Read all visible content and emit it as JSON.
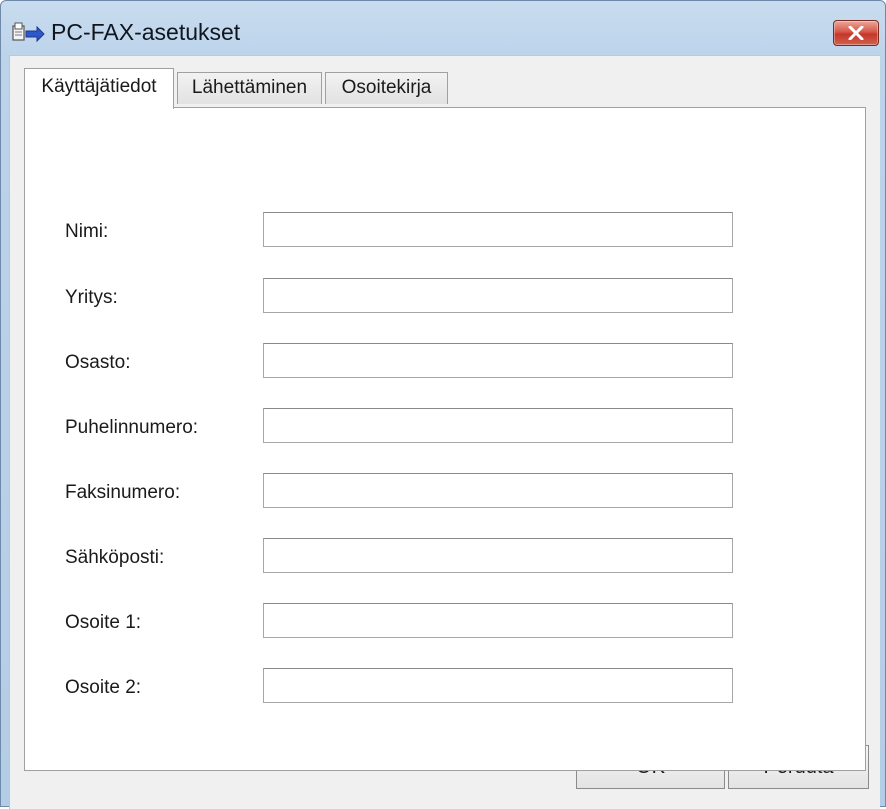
{
  "window": {
    "title": "PC-FAX-asetukset",
    "accent": "#c4372b"
  },
  "icons": {
    "app": "fax-settings-icon",
    "close": "close-icon"
  },
  "tabs": [
    {
      "label": "Käyttäjätiedot",
      "active": true
    },
    {
      "label": "Lähettäminen",
      "active": false
    },
    {
      "label": "Osoitekirja",
      "active": false
    }
  ],
  "form": {
    "name_label": "Nimi:",
    "name_value": "",
    "company_label": "Yritys:",
    "company_value": "",
    "department_label": "Osasto:",
    "department_value": "",
    "phone_label": "Puhelinnumero:",
    "phone_value": "",
    "fax_label": "Faksinumero:",
    "fax_value": "",
    "email_label": "Sähköposti:",
    "email_value": "",
    "address1_label": "Osoite 1:",
    "address1_value": "",
    "address2_label": "Osoite 2:",
    "address2_value": ""
  },
  "buttons": {
    "ok": "OK",
    "cancel": "Peruuta"
  }
}
